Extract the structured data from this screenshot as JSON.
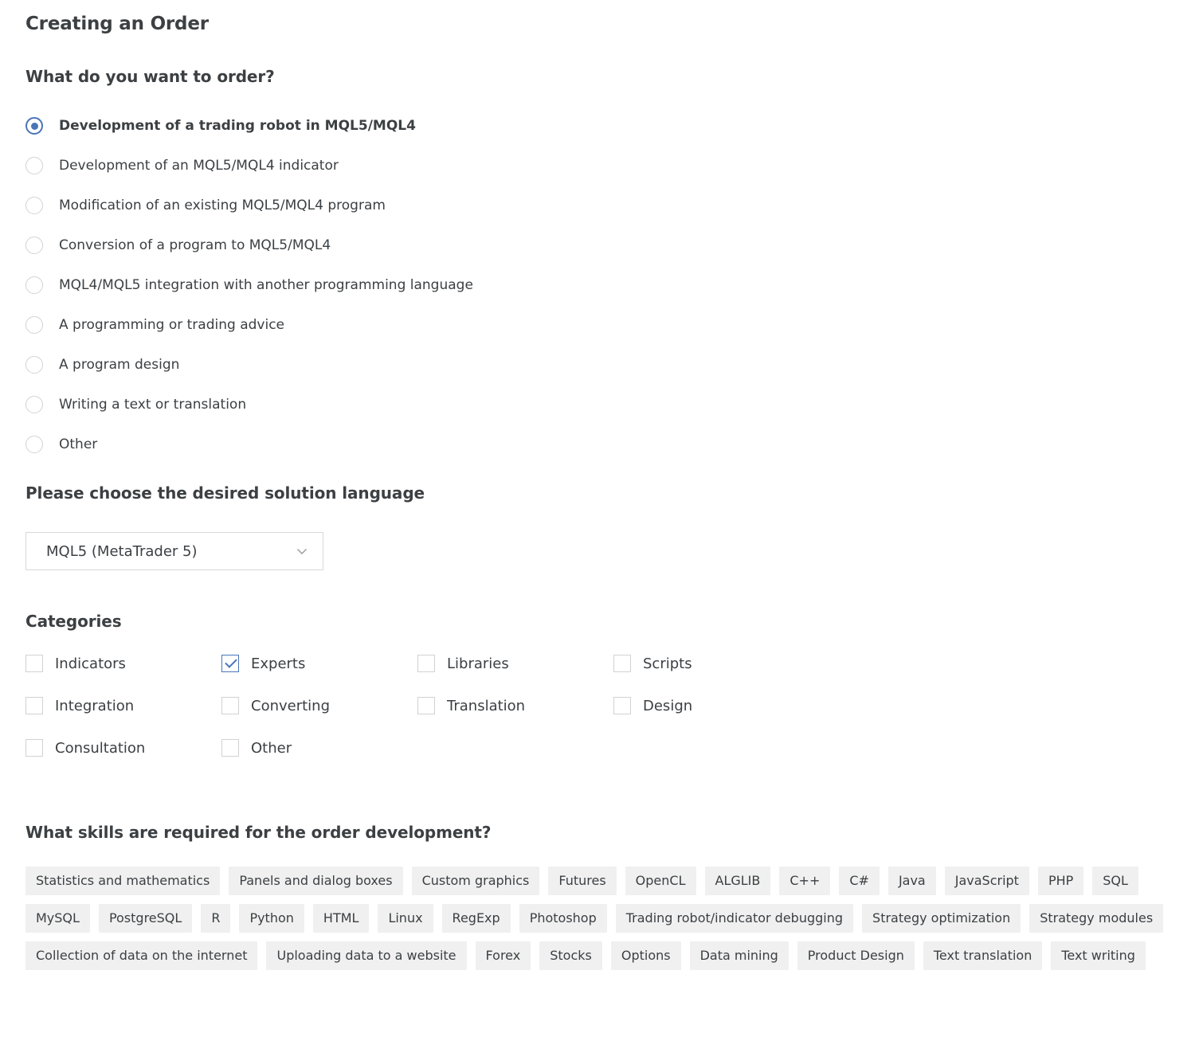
{
  "page": {
    "title": "Creating an Order"
  },
  "order_type": {
    "heading": "What do you want to order?",
    "options": [
      {
        "label": "Development of a trading robot in MQL5/MQL4",
        "selected": true
      },
      {
        "label": "Development of an MQL5/MQL4 indicator",
        "selected": false
      },
      {
        "label": "Modification of an existing MQL5/MQL4 program",
        "selected": false
      },
      {
        "label": "Conversion of a program to MQL5/MQL4",
        "selected": false
      },
      {
        "label": "MQL4/MQL5 integration with another programming language",
        "selected": false
      },
      {
        "label": "A programming or trading advice",
        "selected": false
      },
      {
        "label": "A program design",
        "selected": false
      },
      {
        "label": "Writing a text or translation",
        "selected": false
      },
      {
        "label": "Other",
        "selected": false
      }
    ]
  },
  "language": {
    "heading": "Please choose the desired solution language",
    "selected_value": "MQL5 (MetaTrader 5)",
    "chevron_icon": "chevron-down-icon"
  },
  "categories": {
    "heading": "Categories",
    "items": [
      {
        "label": "Indicators",
        "checked": false
      },
      {
        "label": "Experts",
        "checked": true
      },
      {
        "label": "Libraries",
        "checked": false
      },
      {
        "label": "Scripts",
        "checked": false
      },
      {
        "label": "Integration",
        "checked": false
      },
      {
        "label": "Converting",
        "checked": false
      },
      {
        "label": "Translation",
        "checked": false
      },
      {
        "label": "Design",
        "checked": false
      },
      {
        "label": "Consultation",
        "checked": false
      },
      {
        "label": "Other",
        "checked": false
      }
    ]
  },
  "skills": {
    "heading": "What skills are required for the order development?",
    "tags": [
      "Statistics and mathematics",
      "Panels and dialog boxes",
      "Custom graphics",
      "Futures",
      "OpenCL",
      "ALGLIB",
      "C++",
      "C#",
      "Java",
      "JavaScript",
      "PHP",
      "SQL",
      "MySQL",
      "PostgreSQL",
      "R",
      "Python",
      "HTML",
      "Linux",
      "RegExp",
      "Photoshop",
      "Trading robot/indicator debugging",
      "Strategy optimization",
      "Strategy modules",
      "Collection of data on the internet",
      "Uploading data to a website",
      "Forex",
      "Stocks",
      "Options",
      "Data mining",
      "Product Design",
      "Text translation",
      "Text writing"
    ]
  },
  "colors": {
    "accent": "#4a74b8",
    "text": "#3c4043",
    "tag_background": "#f0f0f0",
    "border": "#d2d2d2"
  }
}
